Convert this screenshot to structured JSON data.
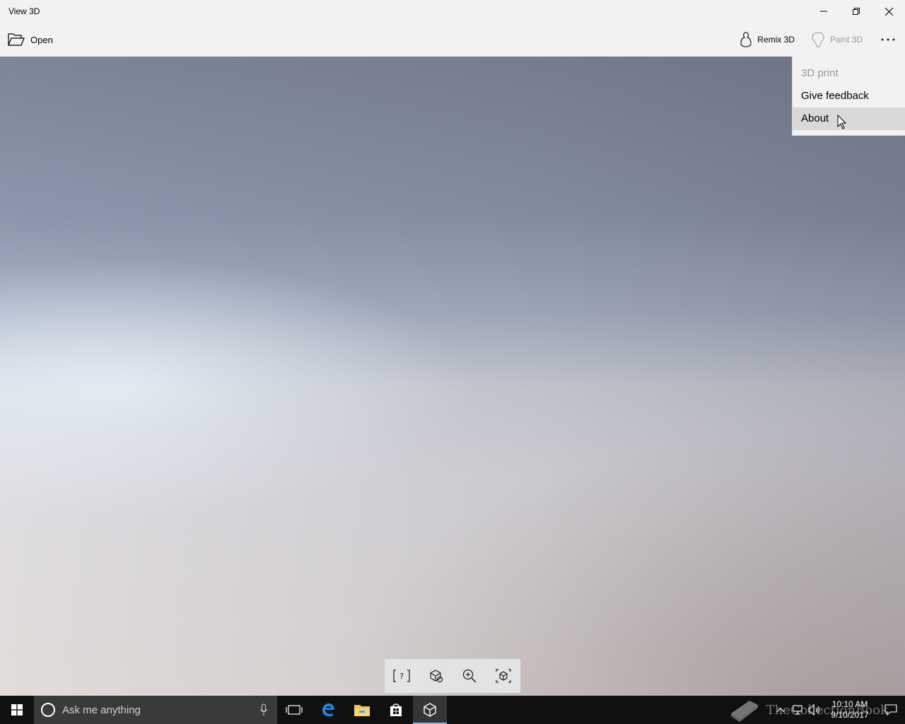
{
  "window": {
    "title": "View 3D"
  },
  "commandbar": {
    "open_label": "Open",
    "remix_label": "Remix 3D",
    "paint3d_label": "Paint 3D"
  },
  "menu": {
    "items": [
      {
        "label": "3D print",
        "disabled": true
      },
      {
        "label": "Give feedback",
        "disabled": false
      },
      {
        "label": "About",
        "disabled": false,
        "hovered": true
      }
    ]
  },
  "viewport_toolbar": {
    "buttons": [
      "mixed-reality-icon",
      "environment-icon",
      "zoom-icon",
      "reset-view-icon"
    ]
  },
  "taskbar": {
    "search_placeholder": "Ask me anything",
    "apps": [
      "task-view-icon",
      "edge-icon",
      "file-explorer-icon",
      "store-icon",
      "view3d-icon"
    ],
    "active_app": "view3d-icon",
    "time": "10:10 AM",
    "date": "9/10/2017"
  },
  "watermark": {
    "text": "TheCollectionBook"
  },
  "colors": {
    "chrome_bg": "#f2f2f2",
    "taskbar_bg": "#101010",
    "accent": "#76b9ed",
    "disabled_text": "#9a9a9a"
  }
}
